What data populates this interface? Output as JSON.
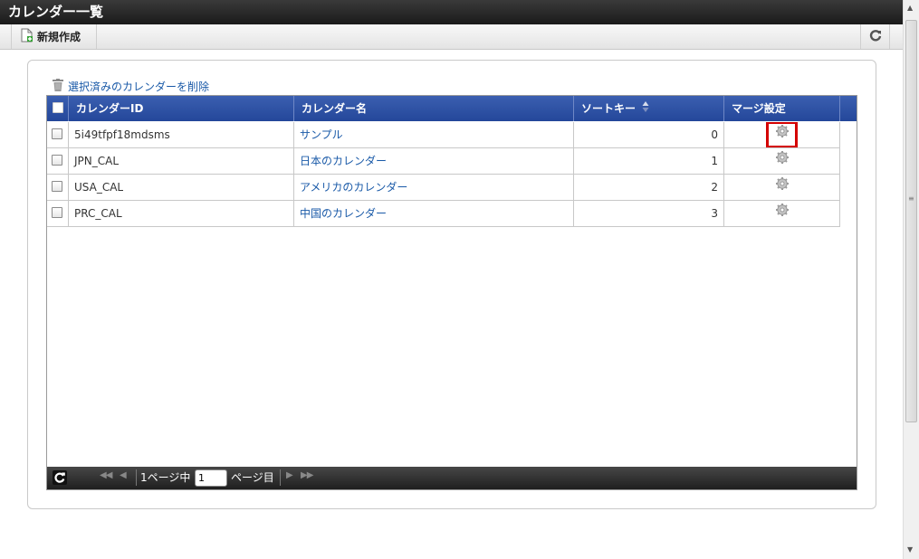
{
  "window": {
    "title": "カレンダー一覧"
  },
  "toolbar": {
    "new_label": "新規作成"
  },
  "delete_link": "選択済みのカレンダーを削除",
  "columns": {
    "id": "カレンダーID",
    "name": "カレンダー名",
    "sort": "ソートキー",
    "merge": "マージ設定"
  },
  "rows": [
    {
      "id": "5i49tfpf18mdsms",
      "name": "サンプル",
      "sort": "0"
    },
    {
      "id": "JPN_CAL",
      "name": "日本のカレンダー",
      "sort": "1"
    },
    {
      "id": "USA_CAL",
      "name": "アメリカのカレンダー",
      "sort": "2"
    },
    {
      "id": "PRC_CAL",
      "name": "中国のカレンダー",
      "sort": "3"
    }
  ],
  "pager": {
    "page_prefix": "1ページ中",
    "page_value": "1",
    "page_suffix": "ページ目"
  },
  "colors": {
    "header_blue": "#2d4fa3",
    "link": "#1a5aa8",
    "highlight": "#d40000"
  }
}
